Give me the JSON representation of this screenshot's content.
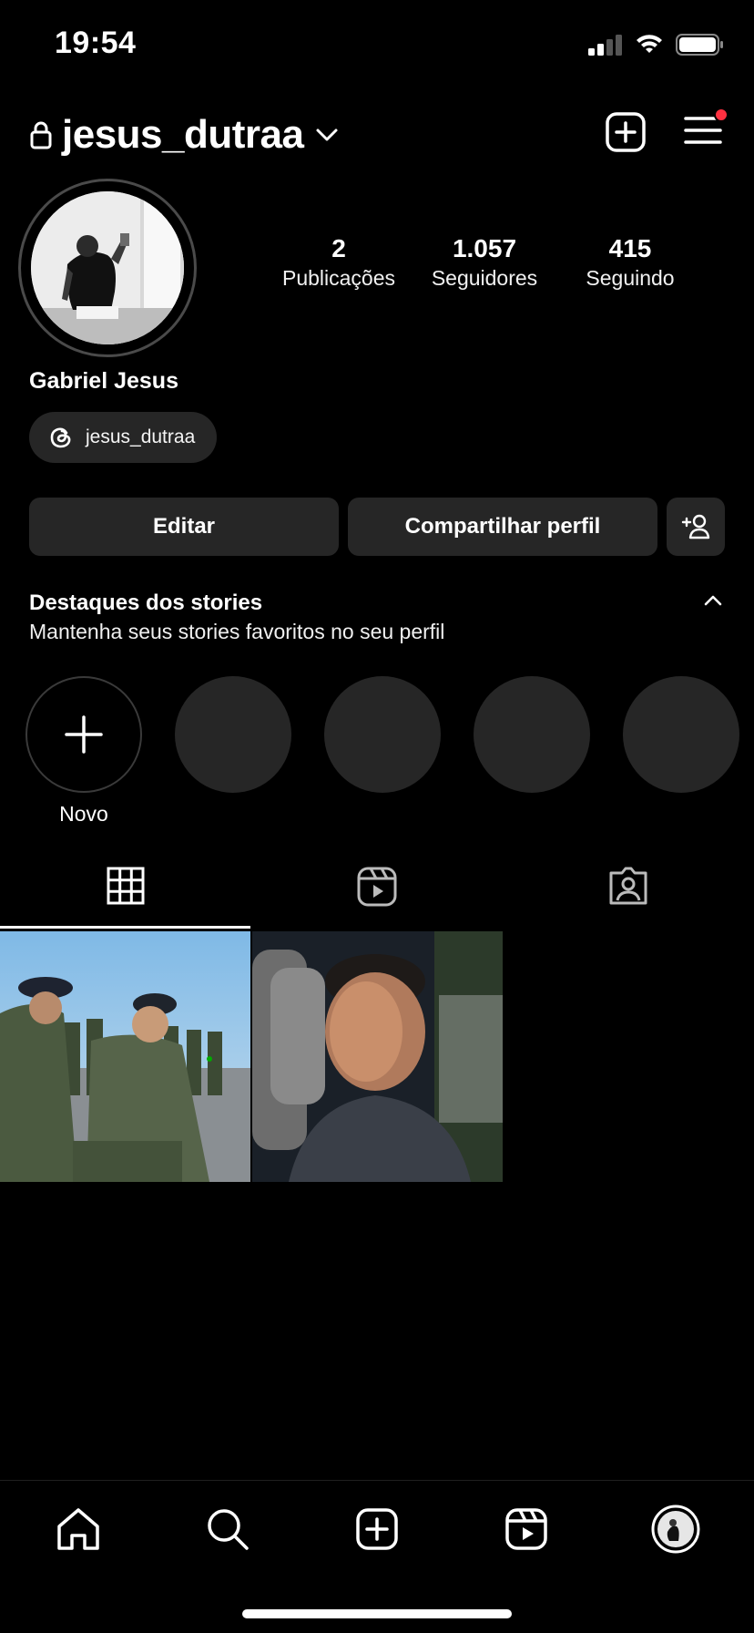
{
  "status_bar": {
    "time": "19:54"
  },
  "header": {
    "username": "jesus_dutraa"
  },
  "profile": {
    "name": "Gabriel Jesus",
    "threads_handle": "jesus_dutraa",
    "stats": [
      {
        "number": "2",
        "label": "Publicações"
      },
      {
        "number": "1.057",
        "label": "Seguidores"
      },
      {
        "number": "415",
        "label": "Seguindo"
      }
    ]
  },
  "actions": {
    "edit": "Editar",
    "share": "Compartilhar perfil"
  },
  "highlights": {
    "title": "Destaques dos stories",
    "subtitle": "Mantenha seus stories favoritos no seu perfil",
    "new_label": "Novo"
  },
  "icons": {
    "lock": "lock-icon",
    "chevron": "chevron-down-icon",
    "create": "plus-square-icon",
    "menu": "hamburger-menu-icon",
    "threads": "threads-icon",
    "add_person": "add-person-icon",
    "tabs": [
      "grid-icon",
      "reels-icon",
      "tagged-icon"
    ],
    "nav": [
      "home-icon",
      "search-icon",
      "create-icon",
      "reels-icon",
      "profile-avatar"
    ]
  },
  "colors": {
    "background": "#000000",
    "surface": "#262626",
    "notification": "#ff3040",
    "text": "#ffffff"
  }
}
